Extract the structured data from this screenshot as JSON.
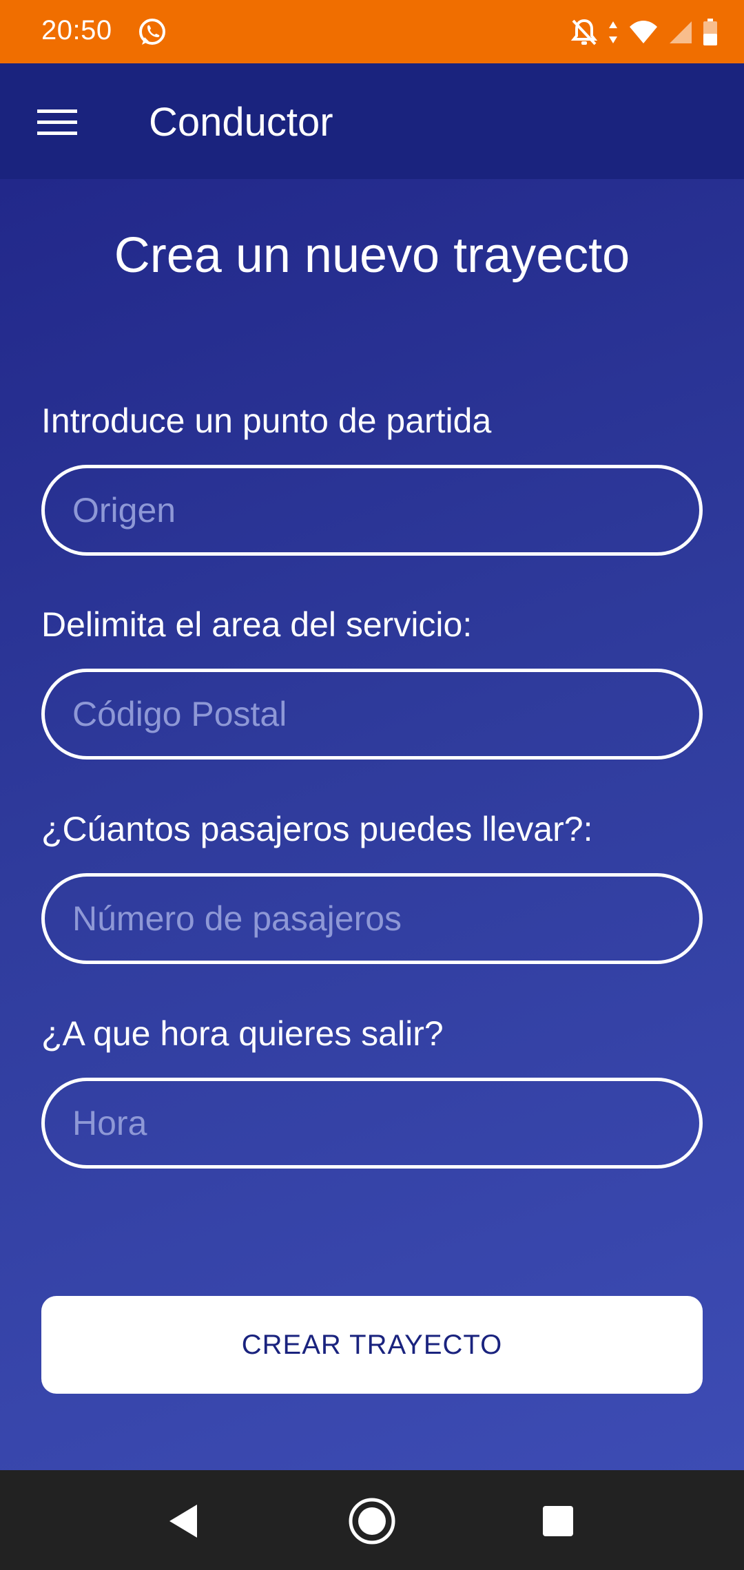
{
  "status_bar": {
    "time": "20:50",
    "icons": [
      "whatsapp-icon",
      "notifications-off-icon",
      "data-arrows-icon",
      "wifi-icon",
      "signal-icon",
      "battery-icon"
    ],
    "color": "#f06e00"
  },
  "app_bar": {
    "title": "Conductor",
    "menu_icon": "hamburger-menu-icon",
    "color": "#1a237e"
  },
  "page": {
    "title": "Crea un nuevo trayecto"
  },
  "form": {
    "origin": {
      "label": "Introduce un punto de partida",
      "placeholder": "Origen"
    },
    "area": {
      "label": "Delimita el area del servicio:",
      "placeholder": "Código Postal"
    },
    "passengers": {
      "label": "¿Cúantos pasajeros puedes llevar?:",
      "placeholder": "Número de pasajeros"
    },
    "time": {
      "label": "¿A que hora quieres salir?",
      "placeholder": "Hora"
    },
    "submit_label": "CREAR TRAYECTO"
  },
  "nav_bar": {
    "icons": [
      "back-icon",
      "home-icon",
      "recents-icon"
    ]
  }
}
